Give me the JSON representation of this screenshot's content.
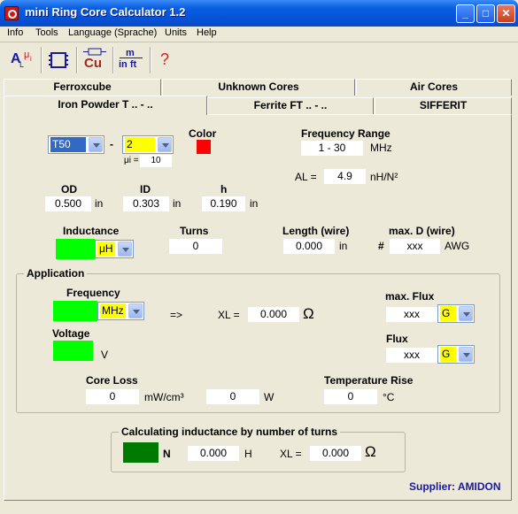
{
  "window": {
    "title": "mini Ring Core Calculator 1.2",
    "buttons": {
      "minimize": "_",
      "maximize": "□",
      "close": "✕"
    }
  },
  "menu": [
    "Info",
    "Tools",
    "Language (Sprache)",
    "Units",
    "Help"
  ],
  "toolbar": {
    "al_mu": "A",
    "al_mu_sub": "L",
    "al_mu_right": "μ",
    "al_mu_right_sub": "i",
    "cu": "Cu",
    "m_in_ft_top": "m",
    "m_in_ft_bottom": "in ft",
    "help": "?"
  },
  "tabs": {
    "row1": [
      "Ferroxcube",
      "Unknown Cores",
      "Air Cores"
    ],
    "row2": [
      "Iron Powder T .. - ..",
      "Ferrite FT .. - ..",
      "SIFFERIT"
    ],
    "active": "Iron Powder T .. - .."
  },
  "core": {
    "size": "T50",
    "separator": "-",
    "mix": "2",
    "mu_label": "μi =",
    "mu_value": "10",
    "color_label": "Color",
    "color_value": "#ff0000"
  },
  "frequency_range": {
    "label": "Frequency Range",
    "value": "1 - 30",
    "unit": "MHz"
  },
  "al": {
    "label": "AL =",
    "value": "4.9",
    "unit": "nH/N²"
  },
  "dimensions": {
    "od": {
      "label": "OD",
      "value": "0.500",
      "unit": "in"
    },
    "id": {
      "label": "ID",
      "value": "0.303",
      "unit": "in"
    },
    "h": {
      "label": "h",
      "value": "0.190",
      "unit": "in"
    }
  },
  "inductance": {
    "label": "Inductance",
    "unit": "μH"
  },
  "turns": {
    "label": "Turns",
    "value": "0"
  },
  "wire_length": {
    "label": "Length (wire)",
    "value": "0.000",
    "unit": "in"
  },
  "wire_diameter": {
    "label": "max. D (wire)",
    "prefix": "#",
    "value": "xxx",
    "unit": "AWG"
  },
  "application": {
    "title": "Application",
    "frequency_label": "Frequency",
    "frequency_unit": "MHz",
    "arrow": "=>",
    "xl_label": "XL =",
    "xl_value": "0.000",
    "xl_unit": "Ω",
    "voltage_label": "Voltage",
    "voltage_unit": "V",
    "max_flux_label": "max. Flux",
    "max_flux_value": "xxx",
    "max_flux_unit": "G",
    "flux_label": "Flux",
    "flux_value": "xxx",
    "flux_unit": "G",
    "core_loss_label": "Core Loss",
    "core_loss_value": "0",
    "core_loss_unit": "mW/cm³",
    "power_value": "0",
    "power_unit": "W",
    "temp_rise_label": "Temperature Rise",
    "temp_rise_value": "0",
    "temp_rise_unit": "°C"
  },
  "calc_turns": {
    "title": "Calculating inductance by number of turns",
    "n_label": "N",
    "h_value": "0.000",
    "h_unit": "H",
    "xl_label": "XL =",
    "xl_value": "0.000",
    "xl_unit": "Ω"
  },
  "supplier": "Supplier: AMIDON",
  "colors": {
    "title_bar": "#0552d8",
    "input_green": "#00ff00",
    "highlight_yellow": "#ffff00",
    "calc_green": "#007a00",
    "supplier": "#1a1a9c"
  }
}
